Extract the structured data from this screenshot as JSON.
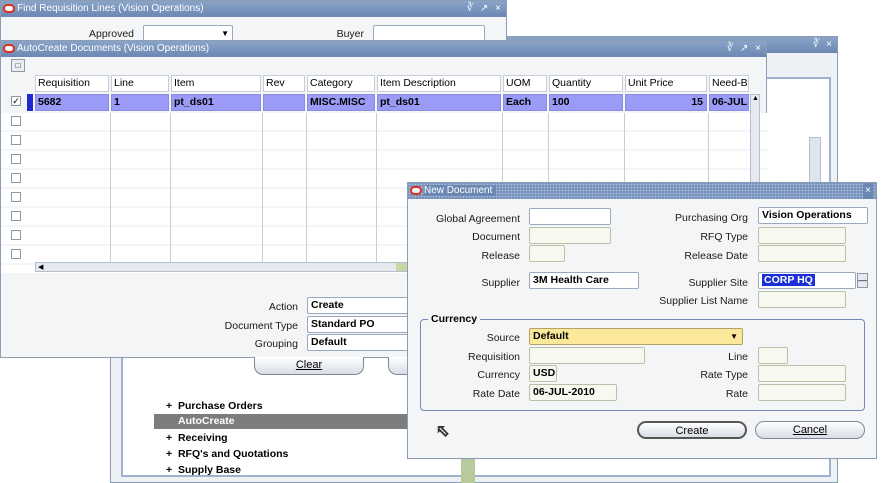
{
  "find_window": {
    "title": "Find Requisition Lines (Vision Operations)",
    "approved_label": "Approved",
    "buyer_label": "Buyer",
    "approved_value": "",
    "buyer_value": ""
  },
  "autocreate_window": {
    "title": "AutoCreate Documents (Vision Operations)",
    "columns": [
      "Requisition",
      "Line",
      "Item",
      "Rev",
      "Category",
      "Item Description",
      "UOM",
      "Quantity",
      "Unit Price",
      "Need-By"
    ],
    "rows": [
      {
        "checked": true,
        "requisition": "5682",
        "line": "1",
        "item": "pt_ds01",
        "rev": "",
        "category": "MISC.MISC",
        "item_description": "pt_ds01",
        "uom": "Each",
        "quantity": "100",
        "unit_price": "15",
        "need_by": "06-JUL"
      }
    ],
    "action_label": "Action",
    "action_value": "Create",
    "document_type_label": "Document Type",
    "document_type_value": "Standard PO",
    "grouping_label": "Grouping",
    "grouping_value": "Default",
    "clear_button": "Clear"
  },
  "navigator": {
    "items": [
      {
        "label": "Purchase Orders",
        "selected": false
      },
      {
        "label": "AutoCreate",
        "selected": true
      },
      {
        "label": "Receiving",
        "selected": false
      },
      {
        "label": "RFQ's and Quotations",
        "selected": false
      },
      {
        "label": "Supply Base",
        "selected": false
      }
    ]
  },
  "new_document": {
    "title": "New Document",
    "global_agreement_label": "Global Agreement",
    "global_agreement_value": "",
    "document_label": "Document",
    "document_value": "",
    "release_label": "Release",
    "release_value": "",
    "purchasing_org_label": "Purchasing Org",
    "purchasing_org_value": "Vision Operations",
    "rfq_type_label": "RFQ Type",
    "rfq_type_value": "",
    "release_date_label": "Release Date",
    "release_date_value": "",
    "supplier_label": "Supplier",
    "supplier_value": "3M Health Care",
    "supplier_site_label": "Supplier Site",
    "supplier_site_value": "CORP HQ",
    "supplier_list_label": "Supplier List Name",
    "supplier_list_value": "",
    "currency_group_label": "Currency",
    "source_label": "Source",
    "source_value": "Default",
    "requisition_label": "Requisition",
    "requisition_value": "",
    "line_label": "Line",
    "line_value": "",
    "currency_label": "Currency",
    "currency_value": "USD",
    "rate_type_label": "Rate Type",
    "rate_type_value": "",
    "rate_date_label": "Rate Date",
    "rate_date_value": "06-JUL-2010",
    "rate_label": "Rate",
    "rate_value": "",
    "create_button": "Create",
    "cancel_button": "Cancel"
  },
  "colors": {
    "titlebar": "#6b88b3",
    "selected_row": "#9a9af7",
    "source_field": "#fce89a",
    "site_highlight": "#1a2fd8",
    "navigator_olive": "#b8c99b"
  }
}
